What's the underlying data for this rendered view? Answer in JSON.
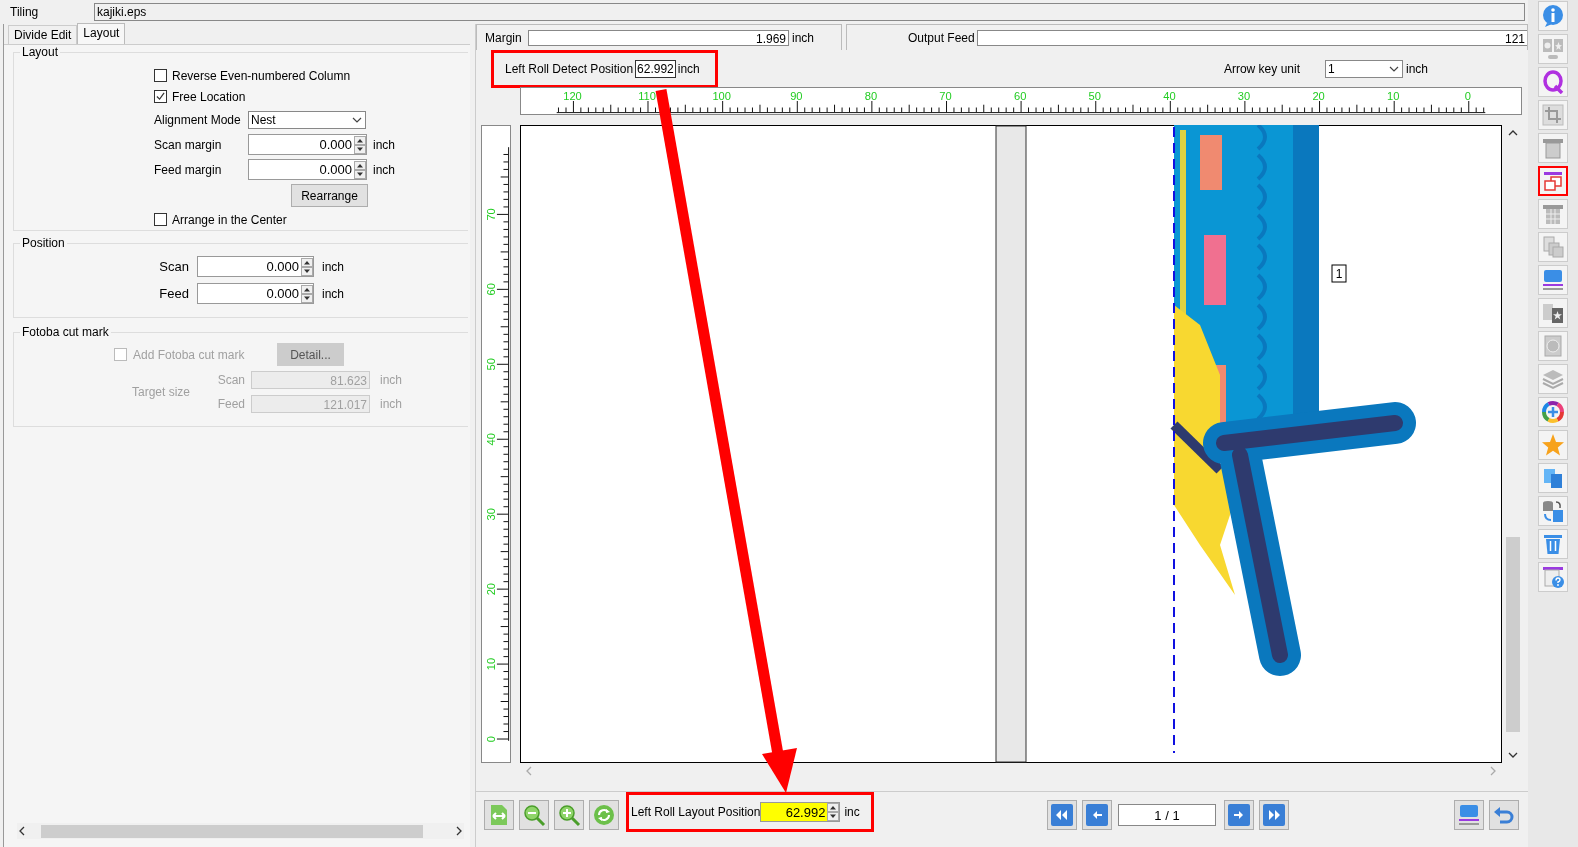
{
  "window": {
    "title": "Tiling",
    "file": "kajiki.eps"
  },
  "tabs": [
    {
      "label": "Divide Edit",
      "selected": false
    },
    {
      "label": "Layout",
      "selected": true
    }
  ],
  "layout_group": {
    "title": "Layout",
    "options": [
      {
        "kind": "checkbox",
        "label": "Reverse Even-numbered Column",
        "checked": false
      },
      {
        "kind": "checkbox",
        "label": "Free Location",
        "checked": true
      },
      {
        "kind": "select",
        "label": "Alignment Mode",
        "value": "Nest"
      },
      {
        "kind": "spin",
        "label": "Scan margin",
        "value": "0.000",
        "unit": "inch"
      },
      {
        "kind": "spin",
        "label": "Feed margin",
        "value": "0.000",
        "unit": "inch"
      },
      {
        "kind": "button",
        "label": "Rearrange"
      },
      {
        "kind": "checkbox",
        "label": "Arrange in the Center",
        "checked": false
      }
    ]
  },
  "position_group": {
    "title": "Position",
    "fields": [
      {
        "label": "Scan",
        "value": "0.000",
        "unit": "inch"
      },
      {
        "label": "Feed",
        "value": "0.000",
        "unit": "inch"
      }
    ]
  },
  "fotoba_group": {
    "title": "Fotoba cut mark",
    "disabled": true,
    "checkbox": {
      "label": "Add Fotoba cut mark",
      "checked": false
    },
    "button": "Detail...",
    "target_size_label": "Target size",
    "fields": [
      {
        "label": "Scan",
        "value": "81.623",
        "unit": "inch"
      },
      {
        "label": "Feed",
        "value": "121.017",
        "unit": "inch"
      }
    ]
  },
  "margin": {
    "label": "Margin",
    "value": "1.969",
    "unit": "inch"
  },
  "output_feed": {
    "label": "Output Feed",
    "value": "121"
  },
  "detect_position": {
    "label": "Left Roll Detect Position",
    "value": "62.992",
    "unit": "inch",
    "highlighted": true
  },
  "arrow_key_unit": {
    "label": "Arrow key unit",
    "value": "1",
    "unit": "inch"
  },
  "ruler": {
    "horizontal_labels": [
      "120",
      "110",
      "100",
      "90",
      "80",
      "70",
      "60",
      "50",
      "40",
      "30",
      "20",
      "10",
      "0"
    ],
    "vertical_labels": [
      "70",
      "60",
      "50",
      "40",
      "30",
      "20",
      "10",
      "0"
    ]
  },
  "canvas": {
    "tile_number": "1"
  },
  "layout_position": {
    "label": "Left Roll Layout Position",
    "value": "62.992",
    "unit": "inc",
    "highlighted": true
  },
  "page_indicator": "1 / 1",
  "right_toolbar": [
    {
      "selected": false
    },
    {
      "selected": false
    },
    {
      "selected": false
    },
    {
      "selected": false
    },
    {
      "selected": false
    },
    {
      "selected": true
    },
    {
      "selected": false
    },
    {
      "selected": false
    },
    {
      "selected": false
    },
    {
      "selected": false
    },
    {
      "selected": false
    },
    {
      "selected": false
    },
    {
      "selected": false
    },
    {
      "selected": false
    },
    {
      "selected": false
    },
    {
      "selected": false
    },
    {
      "selected": false
    },
    {
      "selected": false
    }
  ]
}
